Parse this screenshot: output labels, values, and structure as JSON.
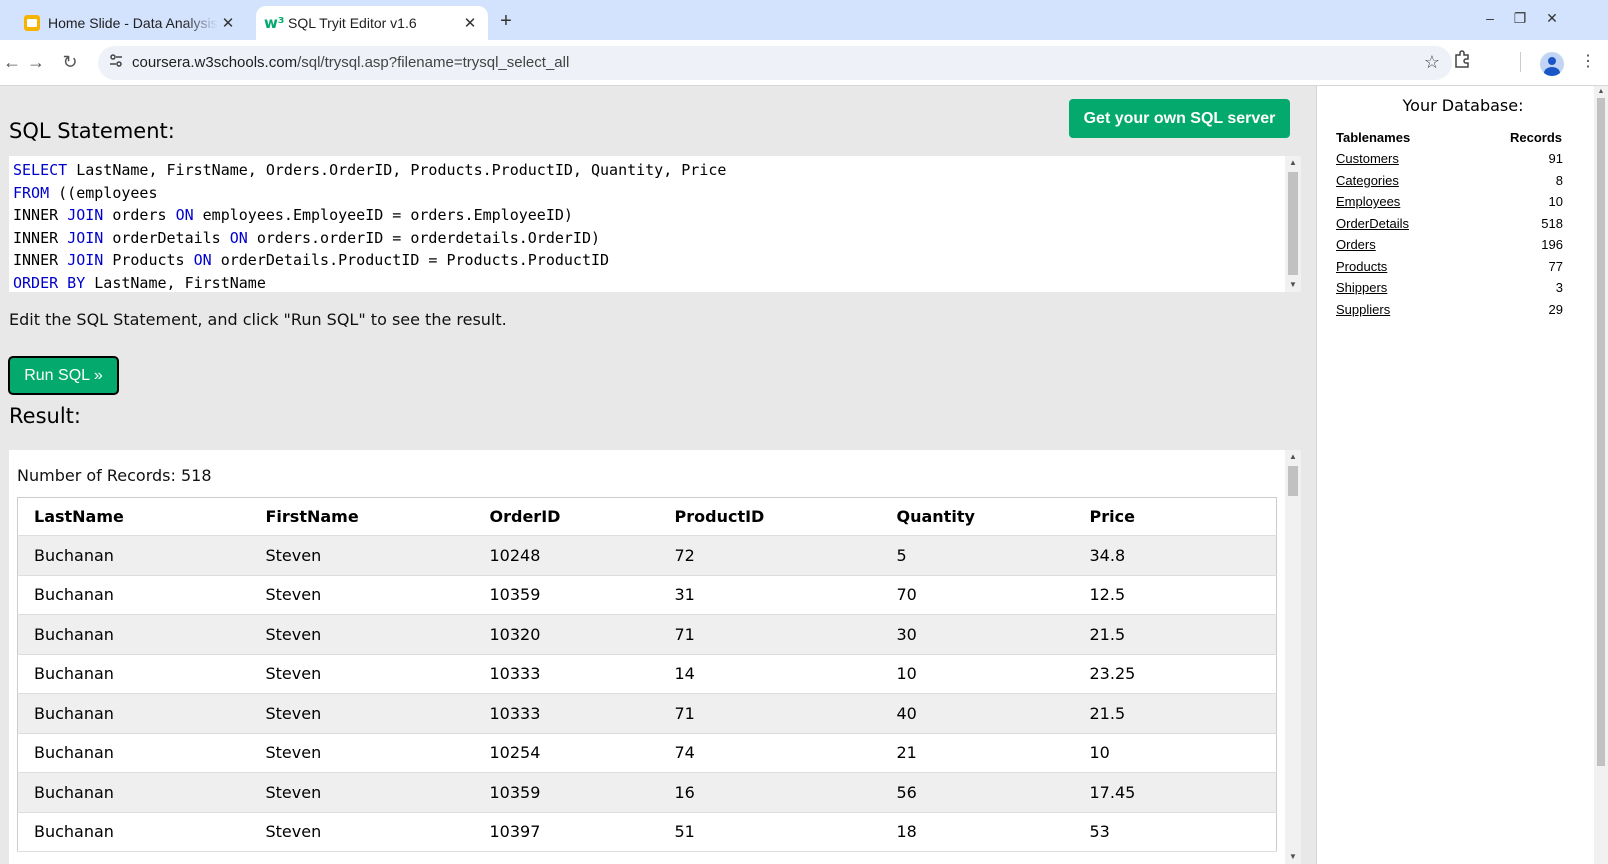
{
  "browser": {
    "tabs": [
      {
        "title": "Home Slide - Data Analysis",
        "close": "✕",
        "active": false
      },
      {
        "title": "SQL Tryit Editor v1.6",
        "close": "✕",
        "active": true
      }
    ],
    "new_tab": "+",
    "window_controls": {
      "minimize": "–",
      "restore": "❐",
      "close": "✕"
    },
    "nav": {
      "back": "←",
      "forward": "→",
      "reload": "↻"
    },
    "url_host": "coursera.w3schools.com",
    "url_path": "/sql/trysql.asp?filename=trysql_select_all",
    "icons": {
      "site_info": "tune-icon",
      "star": "☆",
      "extensions": "puzzle-icon",
      "menu": "⋮"
    }
  },
  "editor_page": {
    "sql_heading": "SQL Statement:",
    "server_button": "Get your own SQL server",
    "sql_lines": [
      [
        {
          "t": "SELECT",
          "kw": true
        },
        {
          "t": " LastName, FirstName, Orders.OrderID, Products.ProductID, Quantity, Price",
          "kw": false
        }
      ],
      [
        {
          "t": "FROM",
          "kw": true
        },
        {
          "t": " ((employees",
          "kw": false
        }
      ],
      [
        {
          "t": "INNER ",
          "kw": false
        },
        {
          "t": "JOIN",
          "kw": true
        },
        {
          "t": " orders ",
          "kw": false
        },
        {
          "t": "ON",
          "kw": true
        },
        {
          "t": " employees.EmployeeID = orders.EmployeeID)",
          "kw": false
        }
      ],
      [
        {
          "t": "INNER ",
          "kw": false
        },
        {
          "t": "JOIN",
          "kw": true
        },
        {
          "t": " orderDetails ",
          "kw": false
        },
        {
          "t": "ON",
          "kw": true
        },
        {
          "t": " orders.orderID = orderdetails.OrderID)",
          "kw": false
        }
      ],
      [
        {
          "t": "INNER ",
          "kw": false
        },
        {
          "t": "JOIN",
          "kw": true
        },
        {
          "t": " Products ",
          "kw": false
        },
        {
          "t": "ON",
          "kw": true
        },
        {
          "t": " orderDetails.ProductID = Products.ProductID",
          "kw": false
        }
      ],
      [
        {
          "t": "ORDER BY",
          "kw": true
        },
        {
          "t": " LastName, FirstName",
          "kw": false
        }
      ]
    ],
    "hint": "Edit the SQL Statement, and click \"Run SQL\" to see the result.",
    "run_button": "Run SQL »",
    "result_heading": "Result:",
    "records_text": "Number of Records: 518"
  },
  "result_table": {
    "columns": [
      "LastName",
      "FirstName",
      "OrderID",
      "ProductID",
      "Quantity",
      "Price"
    ],
    "rows": [
      [
        "Buchanan",
        "Steven",
        "10248",
        "72",
        "5",
        "34.8"
      ],
      [
        "Buchanan",
        "Steven",
        "10359",
        "31",
        "70",
        "12.5"
      ],
      [
        "Buchanan",
        "Steven",
        "10320",
        "71",
        "30",
        "21.5"
      ],
      [
        "Buchanan",
        "Steven",
        "10333",
        "14",
        "10",
        "23.25"
      ],
      [
        "Buchanan",
        "Steven",
        "10333",
        "71",
        "40",
        "21.5"
      ],
      [
        "Buchanan",
        "Steven",
        "10254",
        "74",
        "21",
        "10"
      ],
      [
        "Buchanan",
        "Steven",
        "10359",
        "16",
        "56",
        "17.45"
      ],
      [
        "Buchanan",
        "Steven",
        "10397",
        "51",
        "18",
        "53"
      ]
    ]
  },
  "database": {
    "title": "Your Database:",
    "col_names": "Tablenames",
    "col_records": "Records",
    "tables": [
      {
        "name": "Customers",
        "records": "91"
      },
      {
        "name": "Categories",
        "records": "8"
      },
      {
        "name": "Employees",
        "records": "10"
      },
      {
        "name": "OrderDetails",
        "records": "518"
      },
      {
        "name": "Orders",
        "records": "196"
      },
      {
        "name": "Products",
        "records": "77"
      },
      {
        "name": "Shippers",
        "records": "3"
      },
      {
        "name": "Suppliers",
        "records": "29"
      }
    ]
  },
  "colors": {
    "accent_green": "#04aa6d",
    "keyword_blue": "#0000cd",
    "tabbar": "#d3e3fd"
  }
}
